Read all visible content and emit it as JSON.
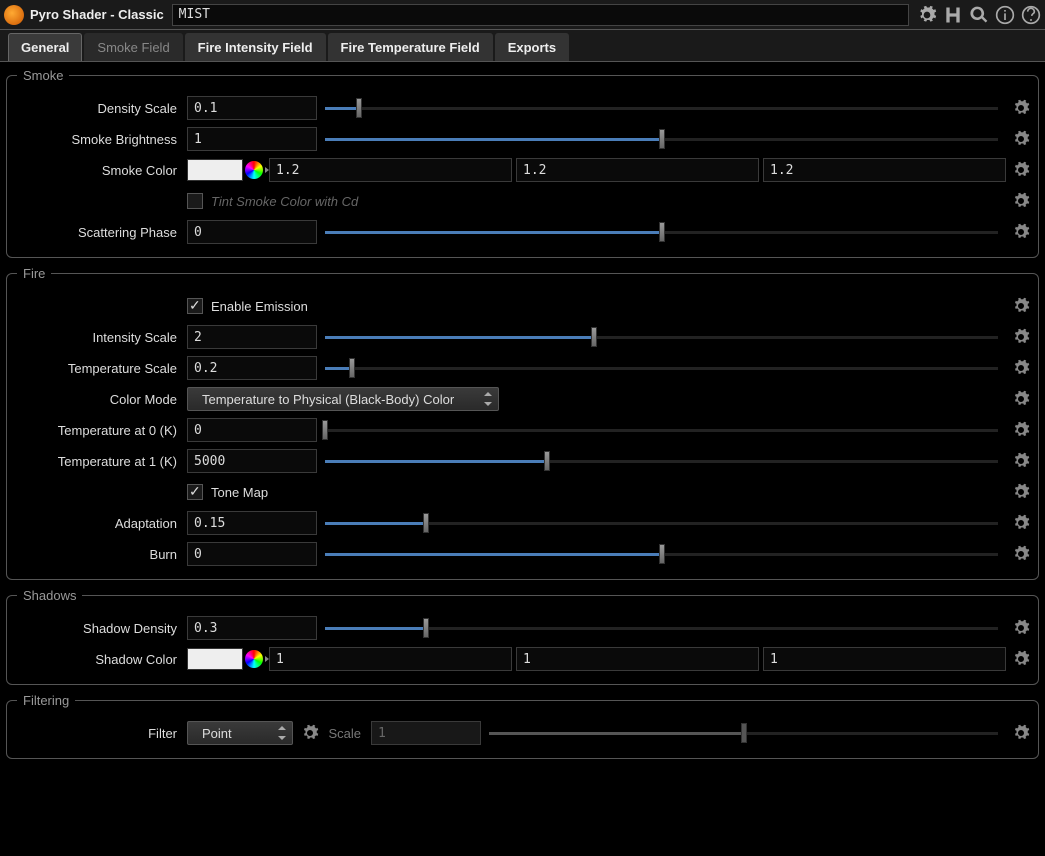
{
  "header": {
    "title": "Pyro Shader - Classic",
    "name": "MIST"
  },
  "tabs": [
    "General",
    "Smoke Field",
    "Fire Intensity Field",
    "Fire Temperature Field",
    "Exports"
  ],
  "smoke": {
    "legend": "Smoke",
    "density_scale": {
      "label": "Density Scale",
      "value": "0.1",
      "pct": 5
    },
    "brightness": {
      "label": "Smoke Brightness",
      "value": "1",
      "pct": 50
    },
    "color": {
      "label": "Smoke Color",
      "r": "1.2",
      "g": "1.2",
      "b": "1.2"
    },
    "tint": {
      "label": "Tint Smoke Color with Cd",
      "checked": false
    },
    "scatter": {
      "label": "Scattering Phase",
      "value": "0",
      "pct": 50
    }
  },
  "fire": {
    "legend": "Fire",
    "enable": {
      "label": "Enable Emission",
      "checked": true
    },
    "intensity": {
      "label": "Intensity Scale",
      "value": "2",
      "pct": 40
    },
    "tscale": {
      "label": "Temperature Scale",
      "value": "0.2",
      "pct": 4
    },
    "color_mode": {
      "label": "Color Mode",
      "value": "Temperature to Physical (Black-Body) Color"
    },
    "t0": {
      "label": "Temperature at 0 (K)",
      "value": "0",
      "pct": 0
    },
    "t1": {
      "label": "Temperature at 1 (K)",
      "value": "5000",
      "pct": 33
    },
    "tonemap": {
      "label": "Tone Map",
      "checked": true
    },
    "adaptation": {
      "label": "Adaptation",
      "value": "0.15",
      "pct": 15
    },
    "burn": {
      "label": "Burn",
      "value": "0",
      "pct": 50
    }
  },
  "shadows": {
    "legend": "Shadows",
    "density": {
      "label": "Shadow Density",
      "value": "0.3",
      "pct": 15
    },
    "color": {
      "label": "Shadow Color",
      "r": "1",
      "g": "1",
      "b": "1"
    }
  },
  "filtering": {
    "legend": "Filtering",
    "filter": {
      "label": "Filter",
      "value": "Point"
    },
    "scale": {
      "label": "Scale",
      "value": "1",
      "pct": 50
    }
  }
}
